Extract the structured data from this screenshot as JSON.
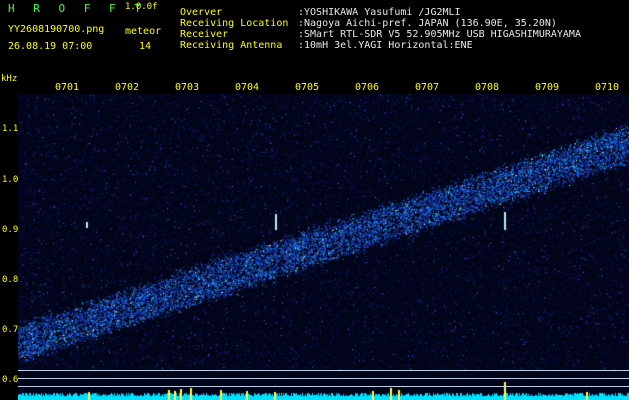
{
  "header": {
    "title": "H R O F F T",
    "version": "1.0.0f",
    "filename": "YY2608190700.png",
    "datetime": "26.08.19 07:00",
    "meteor_label": "meteor",
    "meteor_count": "14"
  },
  "info": [
    {
      "label": "Overver",
      "value": ":YOSHIKAWA Yasufumi /JG2MLI"
    },
    {
      "label": "Receiving Location",
      "value": ":Nagoya Aichi-pref. JAPAN (136.90E, 35.20N)"
    },
    {
      "label": "Receiver",
      "value": ":SMart RTL-SDR V5 52.905MHz USB HIGASHIMURAYAMA"
    },
    {
      "label": "Receiving Antenna",
      "value": ":10mH 3el.YAGI Horizontal:ENE"
    }
  ],
  "axis": {
    "y_unit": "kHz",
    "y_ticks": [
      "1.1",
      "1.0",
      "0.9",
      "0.8",
      "0.7",
      "0.6"
    ],
    "x_ticks": [
      "0701",
      "0702",
      "0703",
      "0704",
      "0705",
      "0706",
      "0707",
      "0708",
      "0709",
      "0710"
    ]
  },
  "colors": {
    "background": "#000000",
    "header_green": "#3cff3c",
    "tick_yellow": "#ffff00",
    "signal_blue": "#2060ff",
    "signal_cyan": "#00e0ff"
  }
}
